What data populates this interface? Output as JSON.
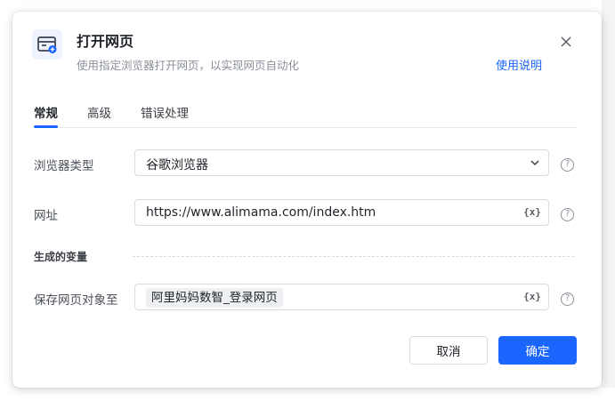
{
  "dialog": {
    "title": "打开网页",
    "subtitle": "使用指定浏览器打开网页，以实现网页自动化",
    "help_link": "使用说明",
    "icon": "browser-window-plus-icon"
  },
  "tabs": [
    {
      "label": "常规",
      "active": true
    },
    {
      "label": "高级",
      "active": false
    },
    {
      "label": "错误处理",
      "active": false
    }
  ],
  "form": {
    "browser_type": {
      "label": "浏览器类型",
      "value": "谷歌浏览器"
    },
    "url": {
      "label": "网址",
      "value": "https://www.alimama.com/index.htm",
      "var_button": "{x}"
    },
    "section_title": "生成的变量",
    "save_to": {
      "label": "保存网页对象至",
      "value": "阿里妈妈数智_登录网页",
      "var_button": "{x}"
    }
  },
  "help_icon_glyph": "?",
  "footer": {
    "cancel_label": "取消",
    "ok_label": "确定"
  },
  "colors": {
    "accent": "#1a66ff",
    "icon_bg": "#eef3ff"
  }
}
